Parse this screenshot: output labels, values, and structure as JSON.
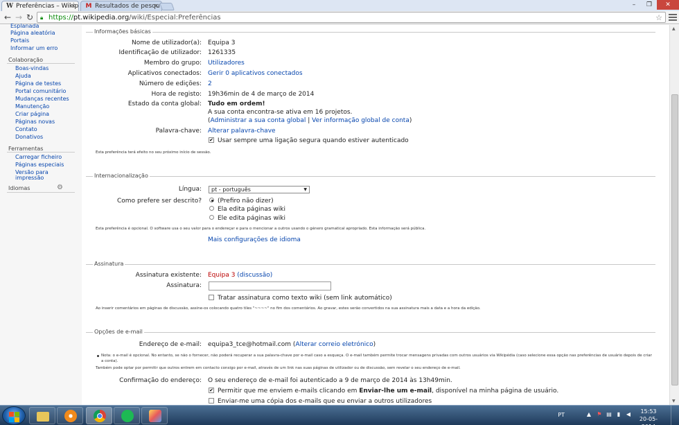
{
  "browser": {
    "tabs": [
      {
        "title": "Preferências – Wikip",
        "favicon": "W",
        "active": true
      },
      {
        "title": "Resultados de pesqu",
        "favicon": "M",
        "active": false
      }
    ],
    "url_scheme": "https://",
    "url_host": "pt.wikipedia.org",
    "url_path": "/wiki/Especial:Preferências"
  },
  "sidebar": {
    "top_items": [
      "Esplanada",
      "Página aleatória",
      "Portais",
      "Informar um erro"
    ],
    "colaboracao_heading": "Colaboração",
    "colaboracao_items": [
      "Boas-vindas",
      "Ajuda",
      "Página de testes",
      "Portal comunitário",
      "Mudanças recentes",
      "Manutenção",
      "Criar página",
      "Páginas novas",
      "Contato",
      "Donativos"
    ],
    "ferramentas_heading": "Ferramentas",
    "ferramentas_items": [
      "Carregar ficheiro",
      "Páginas especiais",
      "Versão para",
      "impressão"
    ],
    "idiomas_heading": "Idiomas",
    "gear_icon": "gear-icon"
  },
  "basic_info": {
    "legend": "Informações básicas",
    "username_label": "Nome de utilizador(a):",
    "username_value": "Equipa 3",
    "userid_label": "Identificação de utilizador:",
    "userid_value": "1261335",
    "group_label": "Membro do grupo:",
    "group_value": "Utilizadores",
    "apps_label": "Aplicativos conectados:",
    "apps_value": "Gerir 0 aplicativos conectados",
    "edits_label": "Número de edições:",
    "edits_value": "2",
    "registered_label": "Hora de registo:",
    "registered_value": "19h36min de 4 de março de 2014",
    "global_label": "Estado da conta global:",
    "global_status": "Tudo em ordem!",
    "global_active": "A sua conta encontra-se ativa em 16 projetos.",
    "global_paren_open": "(",
    "global_manage": "Administrar a sua conta global",
    "global_sep": " | ",
    "global_view": "Ver informação global de conta",
    "global_paren_close": ")",
    "password_label": "Palavra-chave:",
    "password_link": "Alterar palavra-chave",
    "secure_label": "Usar sempre uma ligação segura quando estiver autenticado",
    "secure_checked": true,
    "note": "Esta preferência terá efeito no seu próximo início de sessão."
  },
  "i18n": {
    "legend": "Internacionalização",
    "language_label": "Língua:",
    "language_value": "pt - português",
    "gender_label": "Como prefere ser descrito?",
    "gender_options": [
      "(Prefiro não dizer)",
      "Ela edita páginas wiki",
      "Ele edita páginas wiki"
    ],
    "gender_selected": 0,
    "note": "Esta preferência é opcional. O software usa o seu valor para o endereçar e para o mencionar a outros usando o género gramatical apropriado. Esta informação será pública.",
    "more_link": "Mais configurações de idioma"
  },
  "signature": {
    "legend": "Assinatura",
    "existing_label": "Assinatura existente:",
    "existing_user": "Equipa 3",
    "existing_talk": "(discussão)",
    "field_label": "Assinatura:",
    "field_value": "",
    "raw_label": "Tratar assinatura como texto wiki (sem link automático)",
    "raw_checked": false,
    "note": "Ao inserir comentários em páginas de discussão, assine-os colocando quatro tiles \"~~~~\" no fim dos comentários. Ao gravar, estes serão convertidos na sua assinatura mais a data e a hora da edição."
  },
  "email": {
    "legend": "Opções de e-mail",
    "address_label": "Endereço de e-mail:",
    "address_value": "equipa3_tce@hotmail.com",
    "address_change_open": "(",
    "address_change": "Alterar correio eletrónico",
    "address_change_close": ")",
    "note1": "Nota: o e-mail é opcional. No entanto, se não o fornecer, não poderá recuperar a sua palavra-chave por e-mail caso a esqueça. O e-mail também permite trocar mensagens privadas com outros usuários via Wikipédia (caso selecione essa opção nas preferências de usuário depois de criar",
    "note1b": "a conta).",
    "note2": "Também pode optar por permitir que outros entrem em contacto consigo por e-mail, através de um link nas suas páginas de utilizador ou de discussão, sem revelar o seu endereço de e-mail.",
    "confirm_label": "Confirmação do endereço:",
    "confirm_value": "O seu endereço de e-mail foi autenticado a 9 de março de 2014 às 13h49min.",
    "allow_pre": "Permitir que me enviem e-mails clicando em ",
    "allow_bold": "Enviar-lhe um e-mail",
    "allow_post": ", disponível na minha página de usuário.",
    "allow_checked": true,
    "copy_label": "Enviar-me uma cópia dos e-mails que eu enviar a outros utilizadores",
    "copy_checked": false
  },
  "taskbar": {
    "apps": [
      "start-button",
      "explorer-icon",
      "media-player-icon",
      "chrome-icon",
      "spotify-icon",
      "paint-icon"
    ],
    "language": "PT",
    "time": "15:53",
    "date": "20-05-2014"
  }
}
